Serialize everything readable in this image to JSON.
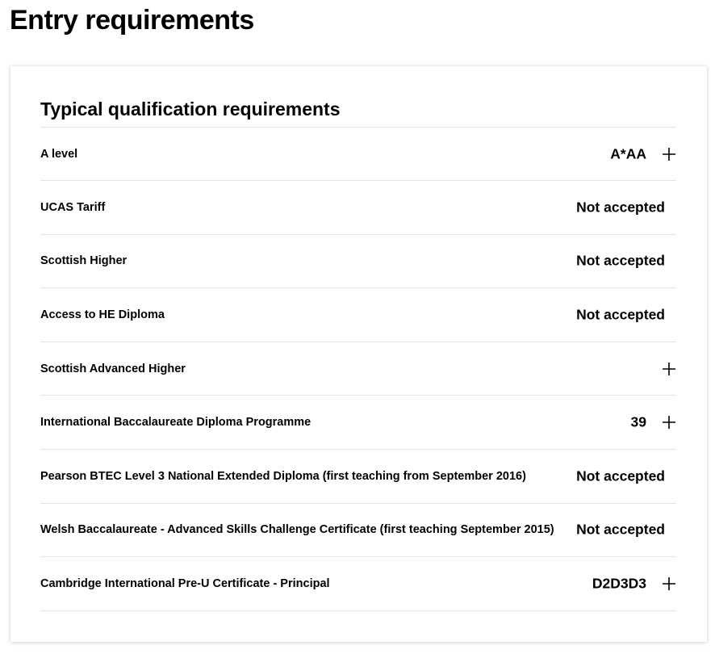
{
  "page": {
    "title": "Entry requirements"
  },
  "card": {
    "title": "Typical qualification requirements"
  },
  "rows": [
    {
      "label": "A level",
      "value": "A*AA",
      "expandable": true
    },
    {
      "label": "UCAS Tariff",
      "value": "Not accepted",
      "expandable": false
    },
    {
      "label": "Scottish Higher",
      "value": "Not accepted",
      "expandable": false
    },
    {
      "label": "Access to HE Diploma",
      "value": "Not accepted",
      "expandable": false
    },
    {
      "label": "Scottish Advanced Higher",
      "value": "",
      "expandable": true
    },
    {
      "label": "International Baccalaureate Diploma Programme",
      "value": "39",
      "expandable": true
    },
    {
      "label": "Pearson BTEC Level 3 National Extended Diploma (first teaching from September 2016)",
      "value": "Not accepted",
      "expandable": false
    },
    {
      "label": "Welsh Baccalaureate - Advanced Skills Challenge Certificate (first teaching September 2015)",
      "value": "Not accepted",
      "expandable": false
    },
    {
      "label": "Cambridge International Pre-U Certificate - Principal",
      "value": "D2D3D3",
      "expandable": true
    }
  ],
  "icons": {
    "expand": "plus-icon"
  },
  "colors": {
    "text": "#000000",
    "divider": "#e4e4e4",
    "background": "#ffffff"
  }
}
